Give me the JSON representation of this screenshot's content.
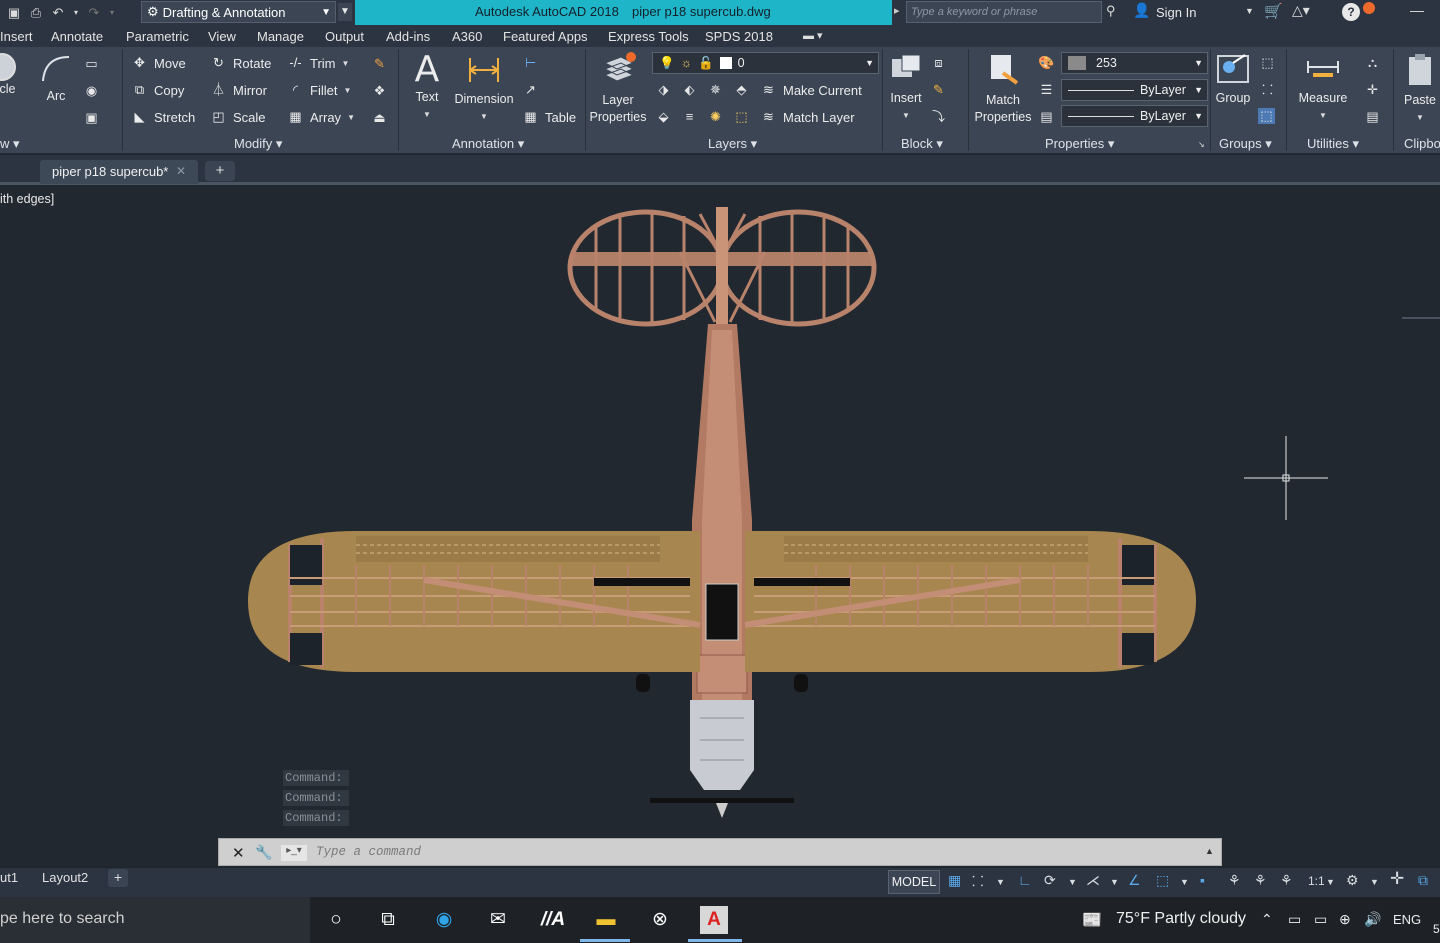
{
  "titlebar": {
    "workspace": "Drafting & Annotation",
    "app_name": "Autodesk AutoCAD 2018",
    "doc_name": "piper p18 supercub.dwg",
    "search_placeholder": "Type a keyword or phrase",
    "sign_in": "Sign In"
  },
  "tabs": [
    "Insert",
    "Annotate",
    "Parametric",
    "View",
    "Manage",
    "Output",
    "Add-ins",
    "A360",
    "Featured Apps",
    "Express Tools",
    "SPDS 2018"
  ],
  "ribbon": {
    "draw": {
      "circle": "ircle",
      "arc": "Arc",
      "panel": "w"
    },
    "modify": {
      "move": "Move",
      "copy": "Copy",
      "stretch": "Stretch",
      "rotate": "Rotate",
      "mirror": "Mirror",
      "scale": "Scale",
      "trim": "Trim",
      "fillet": "Fillet",
      "array": "Array",
      "panel": "Modify"
    },
    "annotation": {
      "text": "Text",
      "dimension": "Dimension",
      "table": "Table",
      "panel": "Annotation"
    },
    "layers": {
      "layer_properties_1": "Layer",
      "layer_properties_2": "Properties",
      "layer_combo": "0",
      "make_current": "Make Current",
      "match_layer": "Match Layer",
      "panel": "Layers"
    },
    "block": {
      "insert": "Insert",
      "panel": "Block"
    },
    "properties": {
      "match_1": "Match",
      "match_2": "Properties",
      "color_value": "253",
      "linetype": "ByLayer",
      "lineweight": "ByLayer",
      "panel": "Properties"
    },
    "groups": {
      "group": "Group",
      "panel": "Groups"
    },
    "utilities": {
      "measure": "Measure",
      "panel": "Utilities"
    },
    "clipboard": {
      "paste": "Paste",
      "panel": "Clipbo"
    }
  },
  "doc_tab": {
    "label": "piper p18 supercub*"
  },
  "viewport": {
    "label": "ith edges]"
  },
  "command": {
    "history": [
      "Command:",
      "Command:",
      "Command:"
    ],
    "placeholder": "Type a command"
  },
  "layout_tabs": [
    "ut1",
    "Layout2"
  ],
  "status": {
    "model": "MODEL",
    "scale": "1:1"
  },
  "taskbar": {
    "search": "pe here to search",
    "weather": "75°F  Partly cloudy",
    "lang": "ENG",
    "clock_fragment": "5"
  },
  "colors": {
    "cyan_title": "#1fb5c8",
    "canvas_bg": "#212830",
    "ribbon_bg": "#3b4554",
    "model_copper": "#b8836a",
    "wing_tan": "#a7864f"
  }
}
